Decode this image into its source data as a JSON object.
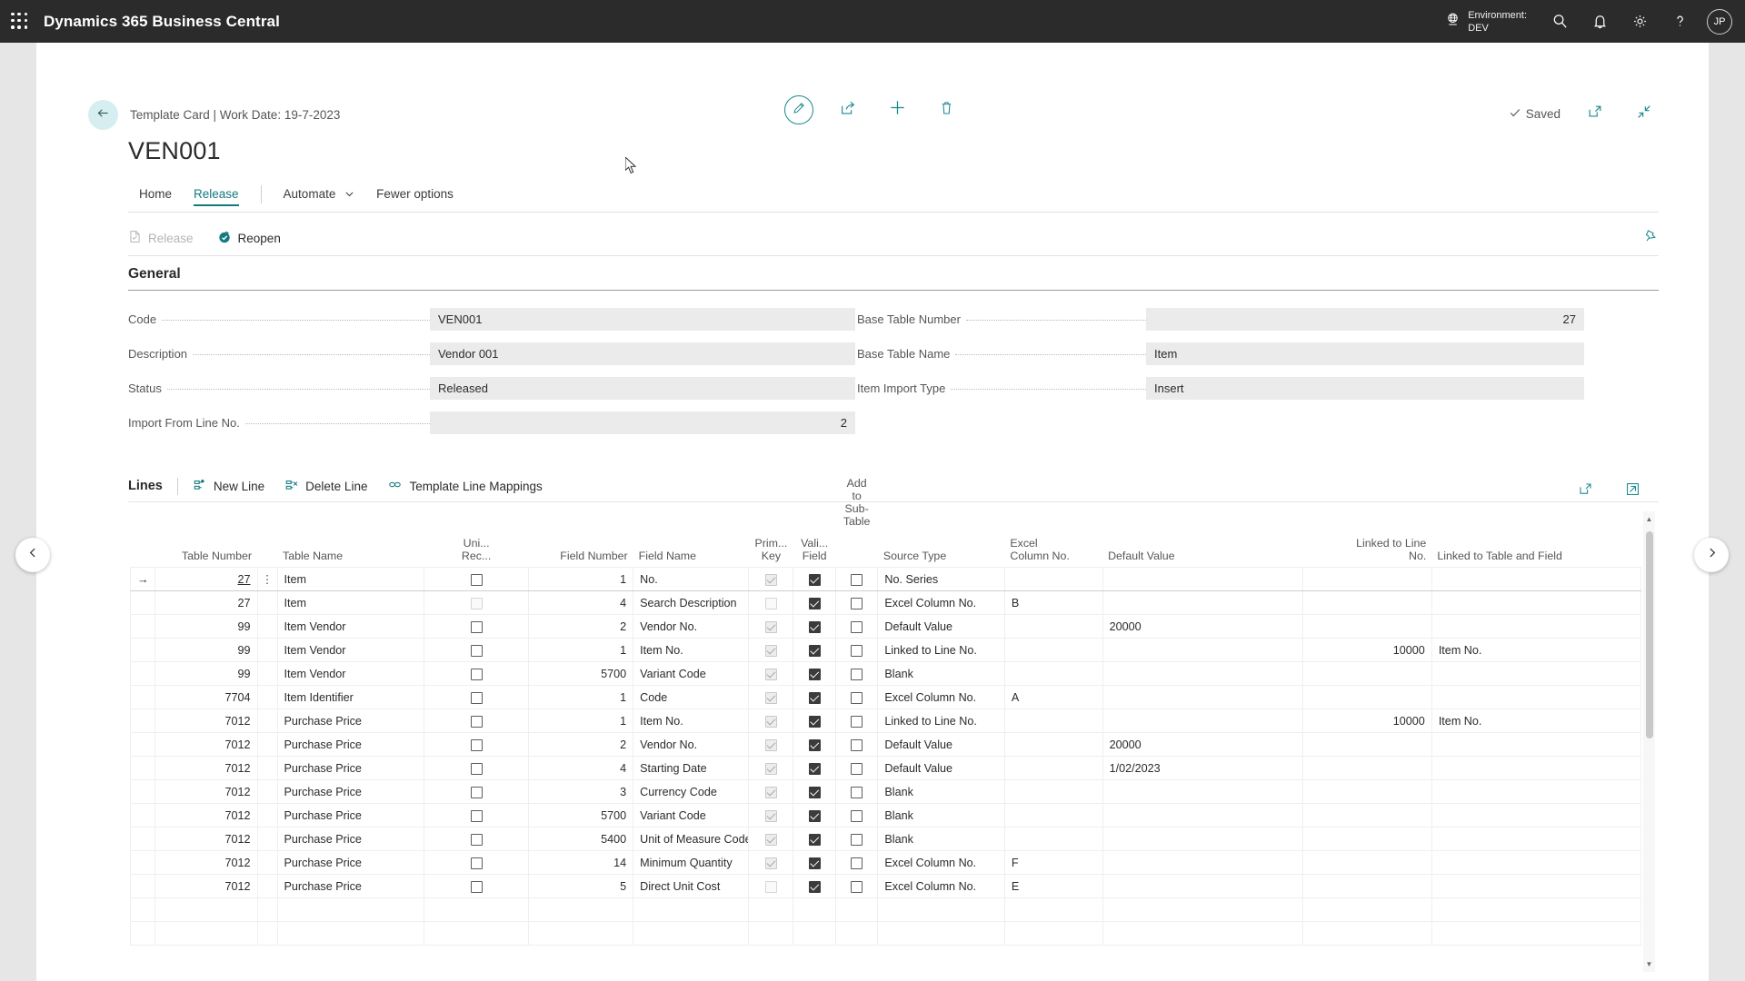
{
  "appbar": {
    "waffle_icon": "app-launcher-icon",
    "title": "Dynamics 365 Business Central",
    "environment_label": "Environment:",
    "environment_name": "DEV",
    "globe_icon": "globe-icon",
    "search_icon": "search-icon",
    "notifications_icon": "bell-icon",
    "settings_icon": "gear-icon",
    "help_icon": "question-icon",
    "avatar_initials": "JP"
  },
  "card": {
    "back_icon": "back-arrow-icon",
    "breadcrumb": "Template Card | Work Date: 19-7-2023",
    "title": "VEN001",
    "tools": {
      "edit_icon": "pencil-icon",
      "share_icon": "share-icon",
      "new_icon": "plus-icon",
      "delete_icon": "trash-icon"
    },
    "saved_label": "Saved",
    "saved_check_icon": "check-icon",
    "open_new_window_icon": "open-in-new-window-icon",
    "collapse_icon": "collapse-icon"
  },
  "ribbon": {
    "tabs": [
      {
        "label": "Home",
        "active": false
      },
      {
        "label": "Release",
        "active": true
      },
      {
        "label": "Automate",
        "active": false,
        "has_chevron": true
      },
      {
        "label": "Fewer options",
        "active": false
      }
    ]
  },
  "actionbar": {
    "actions": [
      {
        "label": "Release",
        "icon": "release-document-icon",
        "disabled": true
      },
      {
        "label": "Reopen",
        "icon": "reopen-icon",
        "disabled": false
      }
    ],
    "pin_icon": "pin-icon"
  },
  "general": {
    "section_title": "General",
    "left_fields": [
      {
        "label": "Code",
        "value": "VEN001",
        "align": "left"
      },
      {
        "label": "Description",
        "value": "Vendor 001",
        "align": "left"
      },
      {
        "label": "Status",
        "value": "Released",
        "align": "left"
      },
      {
        "label": "Import From Line No.",
        "value": "2",
        "align": "right"
      }
    ],
    "right_fields": [
      {
        "label": "Base Table Number",
        "value": "27",
        "align": "right"
      },
      {
        "label": "Base Table Name",
        "value": "Item",
        "align": "left"
      },
      {
        "label": "Item Import Type",
        "value": "Insert",
        "align": "left"
      }
    ]
  },
  "lines": {
    "title": "Lines",
    "actions": [
      {
        "label": "New Line",
        "icon": "new-line-icon"
      },
      {
        "label": "Delete Line",
        "icon": "delete-line-icon"
      },
      {
        "label": "Template Line Mappings",
        "icon": "link-icon"
      }
    ],
    "right_icons": [
      {
        "name": "open-in-excel-icon"
      },
      {
        "name": "expand-grid-icon"
      }
    ],
    "columns": [
      {
        "label": "Table Number",
        "align": "right"
      },
      {
        "label": "Table Name",
        "align": "left"
      },
      {
        "label": "Uni...\nRec...",
        "align": "center"
      },
      {
        "label": "Field Number",
        "align": "right"
      },
      {
        "label": "Field Name",
        "align": "left"
      },
      {
        "label": "Prim...\nKey",
        "align": "center"
      },
      {
        "label": "Vali...\nField",
        "align": "center"
      },
      {
        "label": "Add\nto\nSub-\nTable",
        "align": "center"
      },
      {
        "label": "Source Type",
        "align": "left"
      },
      {
        "label": "Excel\nColumn No.",
        "align": "left"
      },
      {
        "label": "Default Value",
        "align": "left"
      },
      {
        "label": "Linked to Line\nNo.",
        "align": "right"
      },
      {
        "label": "Linked to Table and Field",
        "align": "left"
      }
    ],
    "rows": [
      {
        "selected": true,
        "table_number": "27",
        "table_name": "Item",
        "unique_rec": "unchecked",
        "field_number": "1",
        "field_name": "No.",
        "primary_key": "disabled-checked",
        "validate_field": "checked",
        "add_to_sub_table": "unchecked",
        "source_type": "No. Series",
        "excel_column_no": "",
        "default_value": "",
        "linked_to_line_no": "",
        "linked_to_table_and_field": ""
      },
      {
        "selected": false,
        "table_number": "27",
        "table_name": "Item",
        "unique_rec": "disabled",
        "field_number": "4",
        "field_name": "Search Description",
        "primary_key": "disabled",
        "validate_field": "checked",
        "add_to_sub_table": "unchecked",
        "source_type": "Excel Column No.",
        "excel_column_no": "B",
        "default_value": "",
        "linked_to_line_no": "",
        "linked_to_table_and_field": ""
      },
      {
        "selected": false,
        "table_number": "99",
        "table_name": "Item Vendor",
        "unique_rec": "unchecked",
        "field_number": "2",
        "field_name": "Vendor No.",
        "primary_key": "disabled-checked",
        "validate_field": "checked",
        "add_to_sub_table": "unchecked",
        "source_type": "Default Value",
        "excel_column_no": "",
        "default_value": "20000",
        "linked_to_line_no": "",
        "linked_to_table_and_field": ""
      },
      {
        "selected": false,
        "table_number": "99",
        "table_name": "Item Vendor",
        "unique_rec": "unchecked",
        "field_number": "1",
        "field_name": "Item No.",
        "primary_key": "disabled-checked",
        "validate_field": "checked",
        "add_to_sub_table": "unchecked",
        "source_type": "Linked to Line No.",
        "excel_column_no": "",
        "default_value": "",
        "linked_to_line_no": "10000",
        "linked_to_table_and_field": "Item No."
      },
      {
        "selected": false,
        "table_number": "99",
        "table_name": "Item Vendor",
        "unique_rec": "unchecked",
        "field_number": "5700",
        "field_name": "Variant Code",
        "primary_key": "disabled-checked",
        "validate_field": "checked",
        "add_to_sub_table": "unchecked",
        "source_type": "Blank",
        "excel_column_no": "",
        "default_value": "",
        "linked_to_line_no": "",
        "linked_to_table_and_field": ""
      },
      {
        "selected": false,
        "table_number": "7704",
        "table_name": "Item Identifier",
        "unique_rec": "unchecked",
        "field_number": "1",
        "field_name": "Code",
        "primary_key": "disabled-checked",
        "validate_field": "checked",
        "add_to_sub_table": "unchecked",
        "source_type": "Excel Column No.",
        "excel_column_no": "A",
        "default_value": "",
        "linked_to_line_no": "",
        "linked_to_table_and_field": ""
      },
      {
        "selected": false,
        "table_number": "7012",
        "table_name": "Purchase Price",
        "unique_rec": "unchecked",
        "field_number": "1",
        "field_name": "Item No.",
        "primary_key": "disabled-checked",
        "validate_field": "checked",
        "add_to_sub_table": "unchecked",
        "source_type": "Linked to Line No.",
        "excel_column_no": "",
        "default_value": "",
        "linked_to_line_no": "10000",
        "linked_to_table_and_field": "Item No."
      },
      {
        "selected": false,
        "table_number": "7012",
        "table_name": "Purchase Price",
        "unique_rec": "unchecked",
        "field_number": "2",
        "field_name": "Vendor No.",
        "primary_key": "disabled-checked",
        "validate_field": "checked",
        "add_to_sub_table": "unchecked",
        "source_type": "Default Value",
        "excel_column_no": "",
        "default_value": "20000",
        "linked_to_line_no": "",
        "linked_to_table_and_field": ""
      },
      {
        "selected": false,
        "table_number": "7012",
        "table_name": "Purchase Price",
        "unique_rec": "unchecked",
        "field_number": "4",
        "field_name": "Starting Date",
        "primary_key": "disabled-checked",
        "validate_field": "checked",
        "add_to_sub_table": "unchecked",
        "source_type": "Default Value",
        "excel_column_no": "",
        "default_value": "1/02/2023",
        "linked_to_line_no": "",
        "linked_to_table_and_field": ""
      },
      {
        "selected": false,
        "table_number": "7012",
        "table_name": "Purchase Price",
        "unique_rec": "unchecked",
        "field_number": "3",
        "field_name": "Currency Code",
        "primary_key": "disabled-checked",
        "validate_field": "checked",
        "add_to_sub_table": "unchecked",
        "source_type": "Blank",
        "excel_column_no": "",
        "default_value": "",
        "linked_to_line_no": "",
        "linked_to_table_and_field": ""
      },
      {
        "selected": false,
        "table_number": "7012",
        "table_name": "Purchase Price",
        "unique_rec": "unchecked",
        "field_number": "5700",
        "field_name": "Variant Code",
        "primary_key": "disabled-checked",
        "validate_field": "checked",
        "add_to_sub_table": "unchecked",
        "source_type": "Blank",
        "excel_column_no": "",
        "default_value": "",
        "linked_to_line_no": "",
        "linked_to_table_and_field": ""
      },
      {
        "selected": false,
        "table_number": "7012",
        "table_name": "Purchase Price",
        "unique_rec": "unchecked",
        "field_number": "5400",
        "field_name": "Unit of Measure Code",
        "primary_key": "disabled-checked",
        "validate_field": "checked",
        "add_to_sub_table": "unchecked",
        "source_type": "Blank",
        "excel_column_no": "",
        "default_value": "",
        "linked_to_line_no": "",
        "linked_to_table_and_field": ""
      },
      {
        "selected": false,
        "table_number": "7012",
        "table_name": "Purchase Price",
        "unique_rec": "unchecked",
        "field_number": "14",
        "field_name": "Minimum Quantity",
        "primary_key": "disabled-checked",
        "validate_field": "checked",
        "add_to_sub_table": "unchecked",
        "source_type": "Excel Column No.",
        "excel_column_no": "F",
        "default_value": "",
        "linked_to_line_no": "",
        "linked_to_table_and_field": ""
      },
      {
        "selected": false,
        "table_number": "7012",
        "table_name": "Purchase Price",
        "unique_rec": "unchecked",
        "field_number": "5",
        "field_name": "Direct Unit Cost",
        "primary_key": "disabled",
        "validate_field": "checked",
        "add_to_sub_table": "unchecked",
        "source_type": "Excel Column No.",
        "excel_column_no": "E",
        "default_value": "",
        "linked_to_line_no": "",
        "linked_to_table_and_field": ""
      },
      {
        "selected": false,
        "table_number": "",
        "table_name": "",
        "unique_rec": "none",
        "field_number": "",
        "field_name": "",
        "primary_key": "none",
        "validate_field": "none",
        "add_to_sub_table": "none",
        "source_type": "",
        "excel_column_no": "",
        "default_value": "",
        "linked_to_line_no": "",
        "linked_to_table_and_field": ""
      },
      {
        "selected": false,
        "table_number": "",
        "table_name": "",
        "unique_rec": "none",
        "field_number": "",
        "field_name": "",
        "primary_key": "none",
        "validate_field": "none",
        "add_to_sub_table": "none",
        "source_type": "",
        "excel_column_no": "",
        "default_value": "",
        "linked_to_line_no": "",
        "linked_to_table_and_field": ""
      }
    ]
  },
  "page_nav": {
    "prev_icon": "chevron-left-icon",
    "next_icon": "chevron-right-icon"
  },
  "colors": {
    "accent": "#127a80",
    "appbar_bg": "#2b2b2b",
    "selection_bg": "#cfe9ec",
    "field_bg": "#ebebeb",
    "page_bg": "#e6e6e6"
  }
}
